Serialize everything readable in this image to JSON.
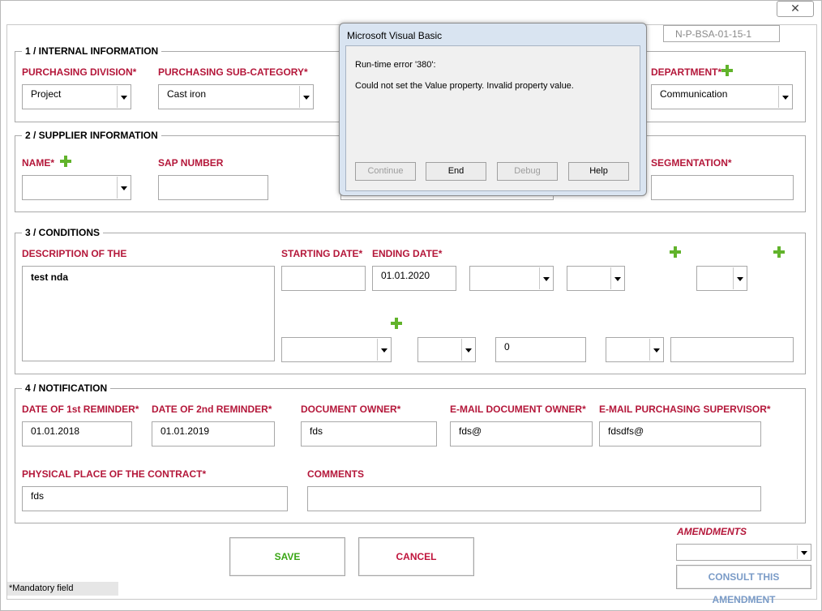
{
  "window": {
    "close_icon": "close-icon",
    "reference": "N-P-BSA-01-15-1"
  },
  "sections": {
    "internal": {
      "title": "1 / INTERNAL INFORMATION",
      "purchasing_division": {
        "label": "PURCHASING DIVISION*",
        "value": "Project"
      },
      "purchasing_sub_category": {
        "label": "PURCHASING SUB-CATEGORY*",
        "value": "Cast iron"
      },
      "department": {
        "label": "DEPARTMENT*",
        "value": "Communication"
      }
    },
    "supplier": {
      "title": "2 / SUPPLIER INFORMATION",
      "name": {
        "label": "NAME*",
        "value": ""
      },
      "sap_number": {
        "label": "SAP NUMBER",
        "value": ""
      },
      "segmentation": {
        "label": "SEGMENTATION*",
        "value": ""
      }
    },
    "conditions": {
      "title": "3 / CONDITIONS",
      "description": {
        "label": "DESCRIPTION OF THE",
        "value": "test nda"
      },
      "starting_date": {
        "label": "STARTING DATE*",
        "value": ""
      },
      "ending_date": {
        "label": "ENDING DATE*",
        "value": "01.01.2020"
      },
      "numeric_value": "0"
    },
    "notification": {
      "title": "4 / NOTIFICATION",
      "first_reminder": {
        "label": "DATE OF 1st REMINDER*",
        "value": "01.01.2018"
      },
      "second_reminder": {
        "label": "DATE OF 2nd REMINDER*",
        "value": "01.01.2019"
      },
      "document_owner": {
        "label": "DOCUMENT OWNER*",
        "value": "fds"
      },
      "email_document_owner": {
        "label": "E-MAIL DOCUMENT OWNER*",
        "value": "fds@"
      },
      "email_purchasing_supervisor": {
        "label": "E-MAIL PURCHASING SUPERVISOR*",
        "value": "fdsdfs@"
      },
      "physical_place": {
        "label": "PHYSICAL PLACE OF THE CONTRACT*",
        "value": "fds"
      },
      "comments": {
        "label": "COMMENTS",
        "value": ""
      }
    }
  },
  "actions": {
    "save": "SAVE",
    "cancel": "CANCEL"
  },
  "amendments": {
    "label": "AMENDMENTS",
    "value": "",
    "consult_button": "CONSULT THIS AMENDMENT"
  },
  "footer": {
    "mandatory_note": "*Mandatory field"
  },
  "dialog": {
    "title": "Microsoft Visual Basic",
    "error_line": "Run-time error '380':",
    "message": "Could not set the Value property. Invalid property value.",
    "buttons": {
      "continue": "Continue",
      "end": "End",
      "debug": "Debug",
      "help": "Help"
    }
  },
  "colors": {
    "label_red": "#b4173a",
    "plus_green": "#61b32b",
    "save_green": "#3aa615",
    "cancel_red": "#c0143c",
    "consult_blue": "#7a9bc7",
    "dialog_frame": "#d9e4f1"
  }
}
